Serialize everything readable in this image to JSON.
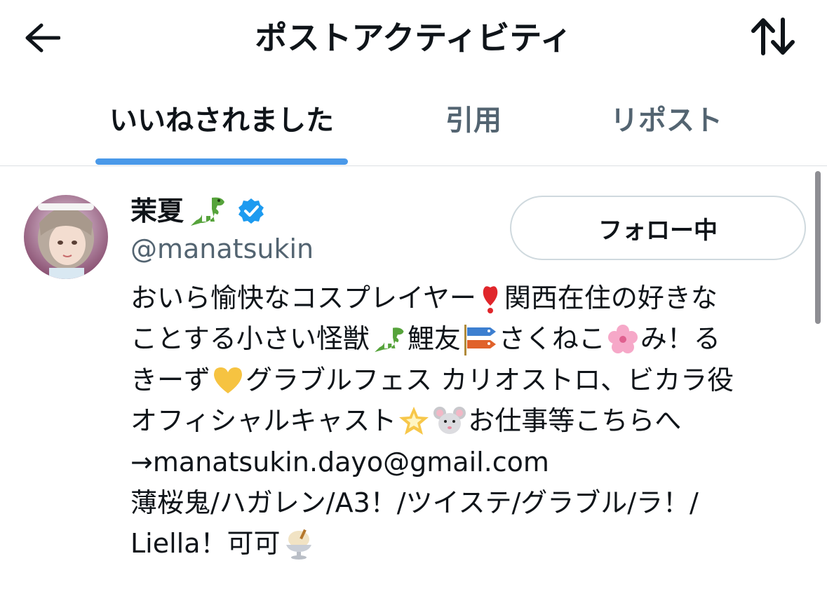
{
  "header": {
    "title": "ポストアクティビティ",
    "back_icon": "arrow-left-icon",
    "sort_icon": "sort-arrows-icon"
  },
  "tabs": [
    {
      "label": "いいねされました",
      "active": true
    },
    {
      "label": "引用",
      "active": false
    },
    {
      "label": "リポスト",
      "active": false
    }
  ],
  "user": {
    "display_name": "茉夏",
    "name_emoji": "t-rex",
    "verified": true,
    "handle": "@manatsukin",
    "follow_label": "フォロー中",
    "bio": {
      "l1a": "おいら愉快なコスプレイヤー",
      "l1b": "関西在住の好きな",
      "l2a": "ことする小さい怪獣",
      "l2b": "鯉友",
      "l2c": "さくねこ",
      "l2d": "み！る",
      "l3a": "きーず",
      "l3b": "グラブルフェス カリオストロ、ビカラ役",
      "l4a": "オフィシャルキャスト",
      "l4b": "お仕事等こちらへ",
      "l5": "→manatsukin.dayo@gmail.com",
      "l6": "薄桜鬼/ハガレン/A3！/ツイステ/グラブル/ラ！/",
      "l7": "Liella！可可"
    }
  },
  "colors": {
    "accent": "#4a99e9",
    "text_primary": "#0f1419",
    "text_secondary": "#536471",
    "verified": "#1d9bf0"
  }
}
